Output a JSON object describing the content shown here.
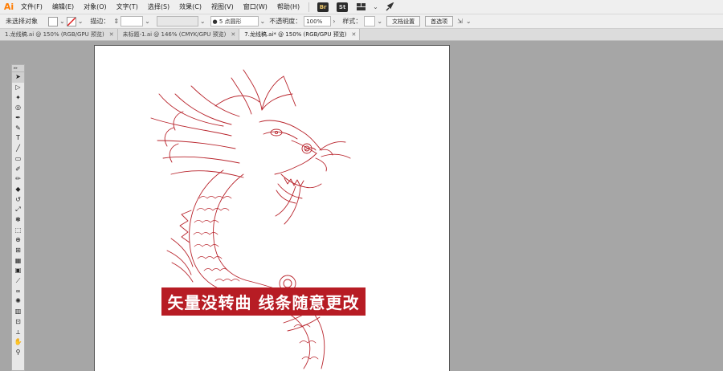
{
  "app": {
    "logo": "Ai",
    "logo_color": "#ff7c00"
  },
  "menu": [
    "文件(F)",
    "编辑(E)",
    "对象(O)",
    "文字(T)",
    "选择(S)",
    "效果(C)",
    "视图(V)",
    "窗口(W)",
    "帮助(H)"
  ],
  "app_buttons": {
    "bridge": "Br",
    "stock": "St"
  },
  "controlbar": {
    "selection": "未选择对象",
    "stroke_label": "描边：",
    "stroke_weight_unit": "",
    "brush_value": "5 点圆形",
    "opacity_label": "不透明度：",
    "opacity_value": "100%",
    "style_label": "样式：",
    "doc_setup": "文档设置",
    "preferences": "首选项"
  },
  "tabs": [
    {
      "label": "1.龙线稿.ai @ 150% (RGB/GPU 预览)",
      "active": false
    },
    {
      "label": "未标题-1.ai @ 146% (CMYK/GPU 预览)",
      "active": false
    },
    {
      "label": "7.龙线稿.ai* @ 150% (RGB/GPU 预览)",
      "active": true
    }
  ],
  "tools": [
    "selection-tool",
    "direct-selection-tool",
    "magic-wand-tool",
    "lasso-tool",
    "pen-tool",
    "curvature-tool",
    "type-tool",
    "line-tool",
    "rectangle-tool",
    "paintbrush-tool",
    "pencil-tool",
    "eraser-tool",
    "rotate-tool",
    "scale-tool",
    "warp-tool",
    "free-transform-tool",
    "shape-builder-tool",
    "perspective-tool",
    "mesh-tool",
    "gradient-tool",
    "eyedropper-tool",
    "blend-tool",
    "symbol-sprayer-tool",
    "column-graph-tool",
    "artboard-tool",
    "slice-tool",
    "hand-tool",
    "zoom-tool"
  ],
  "banner": {
    "text": "矢量没转曲 线条随意更改",
    "bg_color": "#b71c24"
  },
  "colors": {
    "dragon_stroke": "#b8232b",
    "workspace": "#a6a6a6"
  }
}
